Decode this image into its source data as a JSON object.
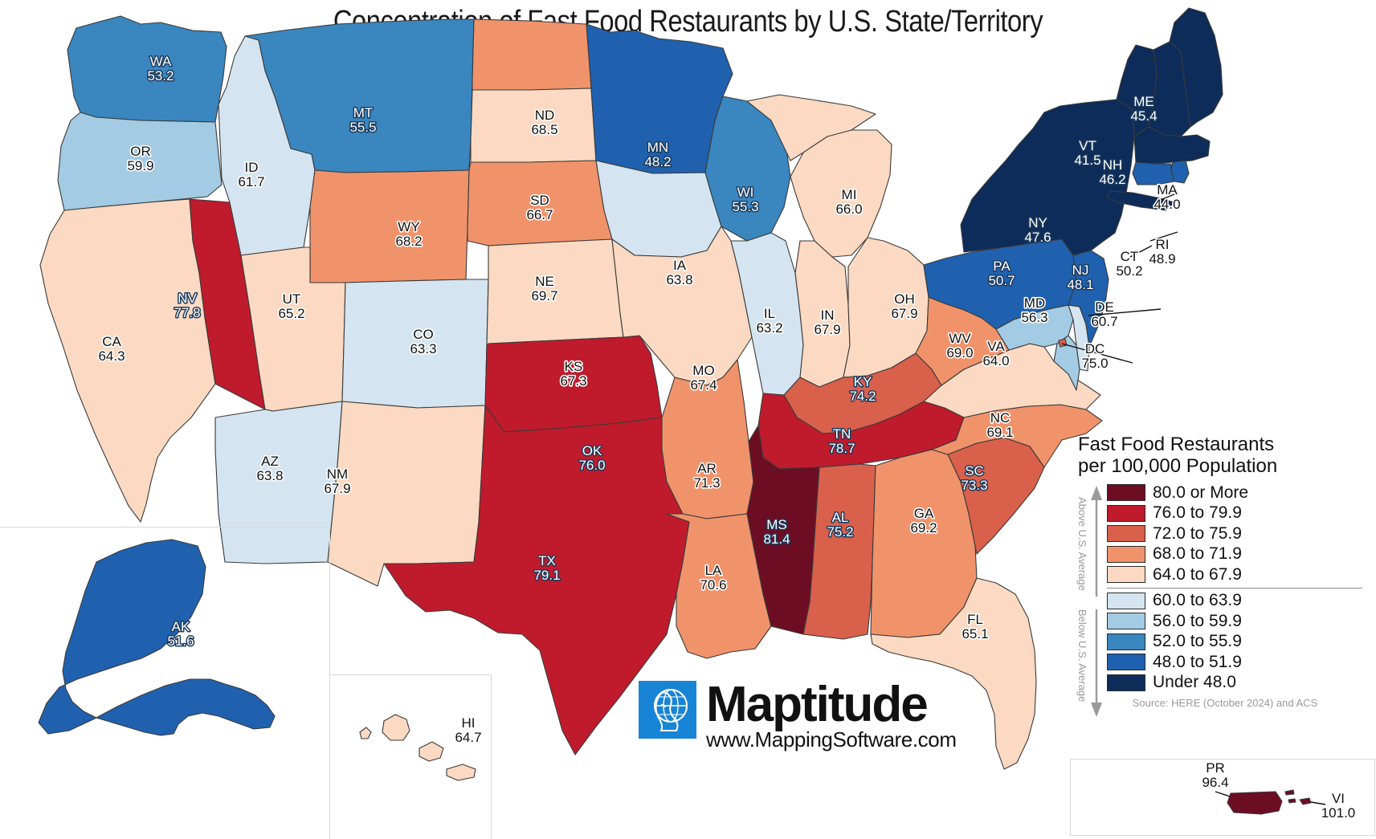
{
  "title": "Concentration of Fast Food Restaurants by U.S. State/Territory",
  "legend": {
    "title_line1": "Fast Food Restaurants",
    "title_line2": "per 100,000 Population",
    "above_label": "Above U.S. Average",
    "below_label": "Below U.S. Average",
    "source": "Source: HERE (October 2024) and ACS",
    "entries": [
      {
        "label": "80.0 or More",
        "color": "#6d0d24"
      },
      {
        "label": "76.0 to 79.9",
        "color": "#bf1b2c"
      },
      {
        "label": "72.0 to 75.9",
        "color": "#d9604b"
      },
      {
        "label": "68.0 to 71.9",
        "color": "#f0936b"
      },
      {
        "label": "64.0 to 67.9",
        "color": "#fbd9c2"
      },
      {
        "label": "60.0 to 63.9",
        "color": "#d4e5f1"
      },
      {
        "label": "56.0 to 59.9",
        "color": "#a3cbe3"
      },
      {
        "label": "52.0 to 55.9",
        "color": "#3a86bf"
      },
      {
        "label": "48.0 to 51.9",
        "color": "#1f61ae"
      },
      {
        "label": "Under 48.0",
        "color": "#0d2c59"
      }
    ]
  },
  "logo": {
    "name": "Maptitude",
    "url": "www.MappingSoftware.com",
    "mark_color": "#1884d6"
  },
  "chart_data": {
    "type": "choropleth",
    "title": "Concentration of Fast Food Restaurants by U.S. State/Territory",
    "unit": "Fast Food Restaurants per 100,000 Population",
    "source": "Source: HERE (October 2024) and ACS",
    "bins": [
      {
        "label": "80.0 or More",
        "min": 80.0,
        "max": null,
        "color": "#6d0d24"
      },
      {
        "label": "76.0 to 79.9",
        "min": 76.0,
        "max": 79.9,
        "color": "#bf1b2c"
      },
      {
        "label": "72.0 to 75.9",
        "min": 72.0,
        "max": 75.9,
        "color": "#d9604b"
      },
      {
        "label": "68.0 to 71.9",
        "min": 68.0,
        "max": 71.9,
        "color": "#f0936b"
      },
      {
        "label": "64.0 to 67.9",
        "min": 64.0,
        "max": 67.9,
        "color": "#fbd9c2"
      },
      {
        "label": "60.0 to 63.9",
        "min": 60.0,
        "max": 63.9,
        "color": "#d4e5f1"
      },
      {
        "label": "56.0 to 59.9",
        "min": 56.0,
        "max": 59.9,
        "color": "#a3cbe3"
      },
      {
        "label": "52.0 to 55.9",
        "min": 52.0,
        "max": 55.9,
        "color": "#3a86bf"
      },
      {
        "label": "48.0 to 51.9",
        "min": 48.0,
        "max": 51.9,
        "color": "#1f61ae"
      },
      {
        "label": "Under 48.0",
        "min": null,
        "max": 47.9,
        "color": "#0d2c59"
      }
    ],
    "regions": [
      {
        "code": "WA",
        "value": 53.2
      },
      {
        "code": "OR",
        "value": 59.9
      },
      {
        "code": "CA",
        "value": 64.3
      },
      {
        "code": "NV",
        "value": 77.8
      },
      {
        "code": "ID",
        "value": 61.7
      },
      {
        "code": "MT",
        "value": 55.5
      },
      {
        "code": "WY",
        "value": 68.2
      },
      {
        "code": "UT",
        "value": 65.2
      },
      {
        "code": "AZ",
        "value": 63.8
      },
      {
        "code": "NM",
        "value": 67.9
      },
      {
        "code": "CO",
        "value": 63.3
      },
      {
        "code": "ND",
        "value": 68.5
      },
      {
        "code": "SD",
        "value": 66.7
      },
      {
        "code": "NE",
        "value": 69.7
      },
      {
        "code": "KS",
        "value": 67.3
      },
      {
        "code": "OK",
        "value": 76.0
      },
      {
        "code": "TX",
        "value": 79.1
      },
      {
        "code": "MN",
        "value": 48.2
      },
      {
        "code": "IA",
        "value": 63.8
      },
      {
        "code": "MO",
        "value": 67.4
      },
      {
        "code": "AR",
        "value": 71.3
      },
      {
        "code": "LA",
        "value": 70.6
      },
      {
        "code": "WI",
        "value": 55.3
      },
      {
        "code": "IL",
        "value": 63.2
      },
      {
        "code": "MI",
        "value": 66.0
      },
      {
        "code": "IN",
        "value": 67.9
      },
      {
        "code": "OH",
        "value": 67.9
      },
      {
        "code": "KY",
        "value": 74.2
      },
      {
        "code": "TN",
        "value": 78.7
      },
      {
        "code": "MS",
        "value": 81.4
      },
      {
        "code": "AL",
        "value": 75.2
      },
      {
        "code": "GA",
        "value": 69.2
      },
      {
        "code": "FL",
        "value": 65.1
      },
      {
        "code": "SC",
        "value": 73.3
      },
      {
        "code": "NC",
        "value": 69.1
      },
      {
        "code": "VA",
        "value": 64.0
      },
      {
        "code": "WV",
        "value": 69.0
      },
      {
        "code": "MD",
        "value": 56.3
      },
      {
        "code": "DE",
        "value": 60.7
      },
      {
        "code": "DC",
        "value": 75.0
      },
      {
        "code": "PA",
        "value": 50.7
      },
      {
        "code": "NJ",
        "value": 48.1
      },
      {
        "code": "NY",
        "value": 47.6
      },
      {
        "code": "CT",
        "value": 50.2
      },
      {
        "code": "RI",
        "value": 48.9
      },
      {
        "code": "MA",
        "value": 44.0
      },
      {
        "code": "VT",
        "value": 41.5
      },
      {
        "code": "NH",
        "value": 46.2
      },
      {
        "code": "ME",
        "value": 45.4
      },
      {
        "code": "AK",
        "value": 51.6
      },
      {
        "code": "HI",
        "value": 64.7
      },
      {
        "code": "PR",
        "value": 96.4
      },
      {
        "code": "VI",
        "value": 101.0
      }
    ]
  },
  "map_labels": {
    "WA": {
      "code": "WA",
      "value": "53.2"
    },
    "OR": {
      "code": "OR",
      "value": "59.9"
    },
    "CA": {
      "code": "CA",
      "value": "64.3"
    },
    "NV": {
      "code": "NV",
      "value": "77.8"
    },
    "ID": {
      "code": "ID",
      "value": "61.7"
    },
    "MT": {
      "code": "MT",
      "value": "55.5"
    },
    "WY": {
      "code": "WY",
      "value": "68.2"
    },
    "UT": {
      "code": "UT",
      "value": "65.2"
    },
    "AZ": {
      "code": "AZ",
      "value": "63.8"
    },
    "NM": {
      "code": "NM",
      "value": "67.9"
    },
    "CO": {
      "code": "CO",
      "value": "63.3"
    },
    "ND": {
      "code": "ND",
      "value": "68.5"
    },
    "SD": {
      "code": "SD",
      "value": "66.7"
    },
    "NE": {
      "code": "NE",
      "value": "69.7"
    },
    "KS": {
      "code": "KS",
      "value": "67.3"
    },
    "OK": {
      "code": "OK",
      "value": "76.0"
    },
    "TX": {
      "code": "TX",
      "value": "79.1"
    },
    "MN": {
      "code": "MN",
      "value": "48.2"
    },
    "IA": {
      "code": "IA",
      "value": "63.8"
    },
    "MO": {
      "code": "MO",
      "value": "67.4"
    },
    "AR": {
      "code": "AR",
      "value": "71.3"
    },
    "LA": {
      "code": "LA",
      "value": "70.6"
    },
    "WI": {
      "code": "WI",
      "value": "55.3"
    },
    "IL": {
      "code": "IL",
      "value": "63.2"
    },
    "MI": {
      "code": "MI",
      "value": "66.0"
    },
    "IN": {
      "code": "IN",
      "value": "67.9"
    },
    "OH": {
      "code": "OH",
      "value": "67.9"
    },
    "KY": {
      "code": "KY",
      "value": "74.2"
    },
    "TN": {
      "code": "TN",
      "value": "78.7"
    },
    "MS": {
      "code": "MS",
      "value": "81.4"
    },
    "AL": {
      "code": "AL",
      "value": "75.2"
    },
    "GA": {
      "code": "GA",
      "value": "69.2"
    },
    "FL": {
      "code": "FL",
      "value": "65.1"
    },
    "SC": {
      "code": "SC",
      "value": "73.3"
    },
    "NC": {
      "code": "NC",
      "value": "69.1"
    },
    "VA": {
      "code": "VA",
      "value": "64.0"
    },
    "WV": {
      "code": "WV",
      "value": "69.0"
    },
    "MD": {
      "code": "MD",
      "value": "56.3"
    },
    "DE": {
      "code": "DE",
      "value": "60.7"
    },
    "DC": {
      "code": "DC",
      "value": "75.0"
    },
    "PA": {
      "code": "PA",
      "value": "50.7"
    },
    "NJ": {
      "code": "NJ",
      "value": "48.1"
    },
    "NY": {
      "code": "NY",
      "value": "47.6"
    },
    "CT": {
      "code": "CT",
      "value": "50.2"
    },
    "RI": {
      "code": "RI",
      "value": "48.9"
    },
    "MA": {
      "code": "MA",
      "value": "44.0"
    },
    "VT": {
      "code": "VT",
      "value": "41.5"
    },
    "NH": {
      "code": "NH",
      "value": "46.2"
    },
    "ME": {
      "code": "ME",
      "value": "45.4"
    },
    "AK": {
      "code": "AK",
      "value": "51.6"
    },
    "HI": {
      "code": "HI",
      "value": "64.7"
    },
    "PR": {
      "code": "PR",
      "value": "96.4"
    },
    "VI": {
      "code": "VI",
      "value": "101.0"
    }
  }
}
